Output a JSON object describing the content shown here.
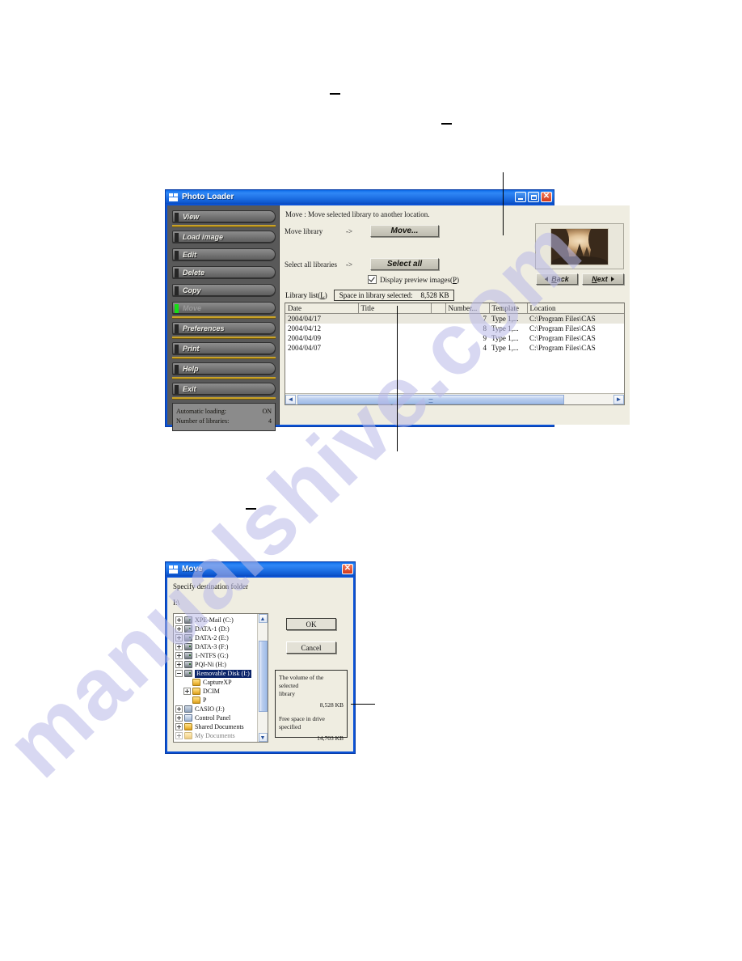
{
  "photo_loader": {
    "title": "Photo Loader",
    "window_buttons": {
      "minimize": "_",
      "maximize": "□",
      "close": "✕"
    },
    "sidebar": {
      "items": [
        {
          "label": "View",
          "active": false
        },
        {
          "label": "Load image",
          "active": false
        },
        {
          "label": "Edit",
          "active": false
        },
        {
          "label": "Delete",
          "active": false
        },
        {
          "label": "Copy",
          "active": false
        },
        {
          "label": "Move",
          "active": true
        },
        {
          "label": "Preferences",
          "active": false
        },
        {
          "label": "Print",
          "active": false
        },
        {
          "label": "Help",
          "active": false
        },
        {
          "label": "Exit",
          "active": false
        }
      ],
      "status": {
        "auto_loading_label": "Automatic loading:",
        "auto_loading_value": "ON",
        "libraries_label": "Number of libraries:",
        "libraries_value": "4"
      }
    },
    "main": {
      "description": "Move : Move selected library to another location.",
      "move_library_label": "Move library",
      "move_library_arrow": "->",
      "move_button": "Move...",
      "select_all_label": "Select all libraries",
      "select_all_arrow": "->",
      "select_all_button": "Select all",
      "display_preview_checkbox": "Display preview images(",
      "display_preview_accel": "P",
      "display_preview_suffix": ")",
      "display_preview_checked": true,
      "back_button": "Back",
      "back_accel": "B",
      "next_button": "Next",
      "next_accel": "N",
      "library_list_label": "Library list(",
      "library_list_accel": "L",
      "library_list_suffix": ")",
      "space_label": "Space in library selected:",
      "space_value": "8,528 KB",
      "table": {
        "columns": [
          "Date",
          "Title",
          "",
          "Number...",
          "Template",
          "Location"
        ],
        "rows": [
          {
            "date": "2004/04/17",
            "title": "",
            "blank": "",
            "number": "7",
            "template": "Type 1,...",
            "location": "C:\\Program Files\\CAS",
            "selected": true
          },
          {
            "date": "2004/04/12",
            "title": "",
            "blank": "",
            "number": "8",
            "template": "Type 1,...",
            "location": "C:\\Program Files\\CAS",
            "selected": false
          },
          {
            "date": "2004/04/09",
            "title": "",
            "blank": "",
            "number": "9",
            "template": "Type 1,...",
            "location": "C:\\Program Files\\CAS",
            "selected": false
          },
          {
            "date": "2004/04/07",
            "title": "",
            "blank": "",
            "number": "4",
            "template": "Type 1,...",
            "location": "C:\\Program Files\\CAS",
            "selected": false
          }
        ]
      },
      "scroll_left": "◄",
      "scroll_right": "►"
    }
  },
  "move_dialog": {
    "title": "Move",
    "close_button": "✕",
    "specify_label": "Specify destination folder",
    "path": "I:\\",
    "ok_button": "OK",
    "cancel_button": "Cancel",
    "tree": [
      {
        "label": "XPE-Mail (C:)",
        "icon": "drive-icon",
        "indent": 0,
        "expander": "plus",
        "selected": false
      },
      {
        "label": "DATA-1 (D:)",
        "icon": "drive-icon",
        "indent": 0,
        "expander": "plus",
        "selected": false
      },
      {
        "label": "DATA-2 (E:)",
        "icon": "drive-icon",
        "indent": 0,
        "expander": "plus",
        "selected": false
      },
      {
        "label": "DATA-3 (F:)",
        "icon": "drive-icon",
        "indent": 0,
        "expander": "plus",
        "selected": false
      },
      {
        "label": "1-NTFS (G:)",
        "icon": "drive-icon",
        "indent": 0,
        "expander": "plus",
        "selected": false
      },
      {
        "label": "PQI-Ni (H:)",
        "icon": "drive-icon",
        "indent": 0,
        "expander": "plus",
        "selected": false
      },
      {
        "label": "Removable Disk (I:)",
        "icon": "drive-icon",
        "indent": 0,
        "expander": "minus",
        "selected": true
      },
      {
        "label": "CaptureXP",
        "icon": "folder-icon",
        "indent": 1,
        "expander": "none",
        "selected": false
      },
      {
        "label": "DCIM",
        "icon": "folder-icon",
        "indent": 1,
        "expander": "plus",
        "selected": false
      },
      {
        "label": "P",
        "icon": "folder-icon",
        "indent": 1,
        "expander": "none",
        "selected": false
      },
      {
        "label": "CASIO (J:)",
        "icon": "network-icon",
        "indent": 0,
        "expander": "plus",
        "selected": false
      },
      {
        "label": "Control Panel",
        "icon": "control-panel-icon",
        "indent": 0,
        "expander": "plus",
        "selected": false
      },
      {
        "label": "Shared Documents",
        "icon": "folder-icon",
        "indent": 0,
        "expander": "plus",
        "selected": false
      },
      {
        "label": "My Documents",
        "icon": "folder-icon",
        "indent": 0,
        "expander": "plus",
        "selected": false
      }
    ],
    "volume_box": {
      "line1": "The volume of the selected",
      "line2": "library",
      "volume_value": "8,528  KB",
      "free_label": "Free space in drive specified",
      "free_value": "14,703  KB"
    },
    "scroll_up": "▲",
    "scroll_down": "▼"
  },
  "page": {
    "watermark": "manualshive.com"
  }
}
